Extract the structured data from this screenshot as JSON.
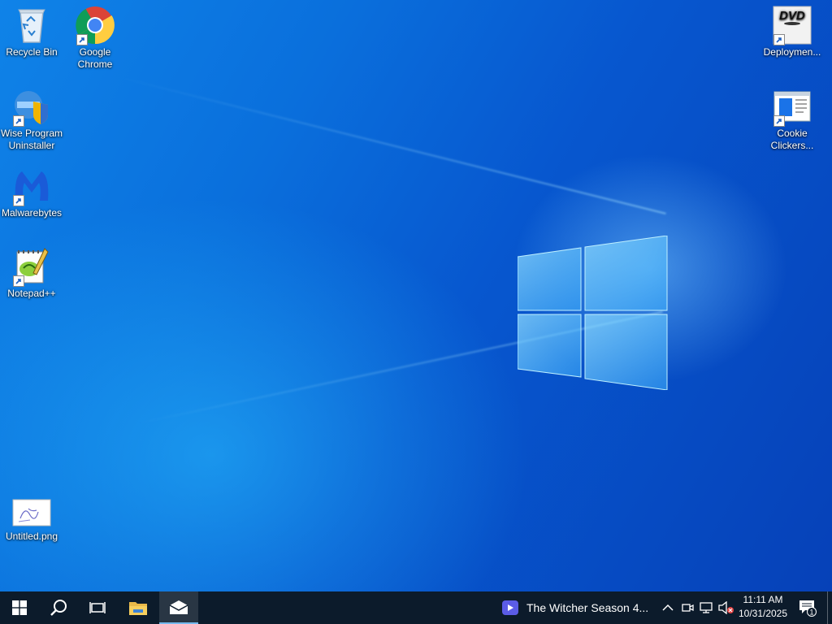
{
  "desktop": {
    "icons": {
      "recycle_bin": "Recycle Bin",
      "google_chrome": "Google Chrome",
      "wise_uninstaller": "Wise Program Uninstaller",
      "malwarebytes": "Malwarebytes",
      "notepadpp": "Notepad++",
      "untitled_png": "Untitled.png",
      "deployment": "Deploymen...",
      "cookie_clickers": "Cookie Clickers..."
    },
    "dvd_text": "DVD"
  },
  "taskbar": {
    "now_playing": "The Witcher Season 4...",
    "clock_time": "11:11 AM",
    "clock_date": "10/31/2025",
    "notification_count": "1",
    "icons": [
      "windows-start-icon",
      "search-icon",
      "task-view-icon",
      "file-explorer-icon",
      "mail-icon",
      "chevron-up-icon",
      "meet-now-icon",
      "network-icon",
      "volume-muted-icon",
      "notification-icon"
    ]
  },
  "colors": {
    "taskbar_bg": "#0c1b2b",
    "accent": "#76b9ed",
    "wallpaper_blue": "#0a6fdc"
  }
}
